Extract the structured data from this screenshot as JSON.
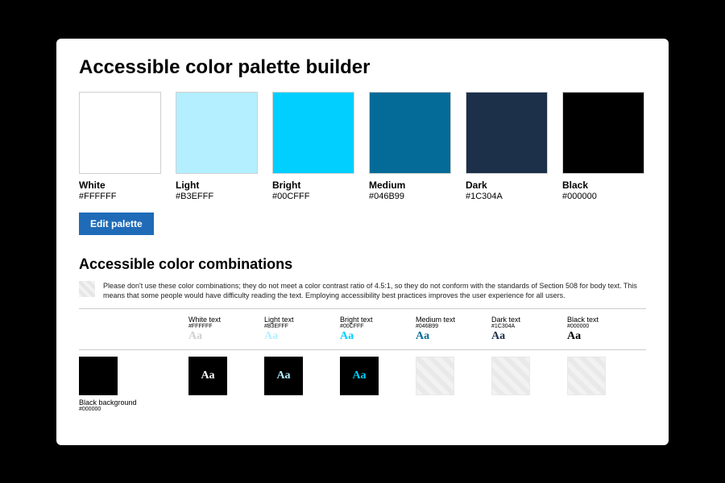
{
  "title": "Accessible color palette builder",
  "edit_label": "Edit palette",
  "swatches": [
    {
      "name": "White",
      "hex": "#FFFFFF",
      "color": "#FFFFFF"
    },
    {
      "name": "Light",
      "hex": "#B3EFFF",
      "color": "#B3EFFF"
    },
    {
      "name": "Bright",
      "hex": "#00CFFF",
      "color": "#00CFFF"
    },
    {
      "name": "Medium",
      "hex": "#046B99",
      "color": "#046B99"
    },
    {
      "name": "Dark",
      "hex": "#1C304A",
      "color": "#1C304A"
    },
    {
      "name": "Black",
      "hex": "#000000",
      "color": "#000000"
    }
  ],
  "section2_title": "Accessible color combinations",
  "warning_text": "Please don't use these color combinations; they do not meet a color contrast ratio of 4.5:1, so they do not conform with the standards of Section 508 for body text. This means that some people would have difficulty reading the text. Employing accessibility best practices improves the user experience for all users.",
  "combo_headers": [
    {
      "label": "White text",
      "hex": "#FFFFFF",
      "aa_color": "#cfcfcf"
    },
    {
      "label": "Light text",
      "hex": "#B3EFFF",
      "aa_color": "#B3EFFF"
    },
    {
      "label": "Bright text",
      "hex": "#00CFFF",
      "aa_color": "#00CFFF"
    },
    {
      "label": "Medium text",
      "hex": "#046B99",
      "aa_color": "#046B99"
    },
    {
      "label": "Dark text",
      "hex": "#1C304A",
      "aa_color": "#1C304A"
    },
    {
      "label": "Black text",
      "hex": "#000000",
      "aa_color": "#000000"
    }
  ],
  "combo_row": {
    "bg_label": "Black background",
    "bg_hex": "#000000",
    "bg_color": "#000000",
    "cells": [
      {
        "valid": true,
        "text_color": "#FFFFFF"
      },
      {
        "valid": true,
        "text_color": "#B3EFFF"
      },
      {
        "valid": true,
        "text_color": "#00CFFF"
      },
      {
        "valid": false,
        "text_color": ""
      },
      {
        "valid": false,
        "text_color": ""
      },
      {
        "valid": false,
        "text_color": ""
      }
    ]
  },
  "sample_text": "Aa"
}
